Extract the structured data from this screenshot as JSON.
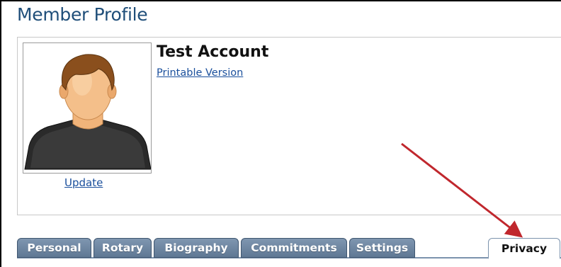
{
  "page": {
    "title": "Member Profile"
  },
  "profile": {
    "name": "Test Account",
    "printable_link": "Printable Version",
    "update_link": "Update",
    "avatar_icon": "default-user-avatar"
  },
  "tabs": [
    {
      "label": "Personal",
      "active": false
    },
    {
      "label": "Rotary",
      "active": false
    },
    {
      "label": "Biography",
      "active": false
    },
    {
      "label": "Commitments",
      "active": false
    },
    {
      "label": "Settings",
      "active": false
    },
    {
      "label": "Privacy",
      "active": true
    }
  ],
  "colors": {
    "title": "#1f4e79",
    "link": "#1a4f9c",
    "tab_bg": "#6f87a2",
    "annotation_arrow": "#c0272d"
  }
}
